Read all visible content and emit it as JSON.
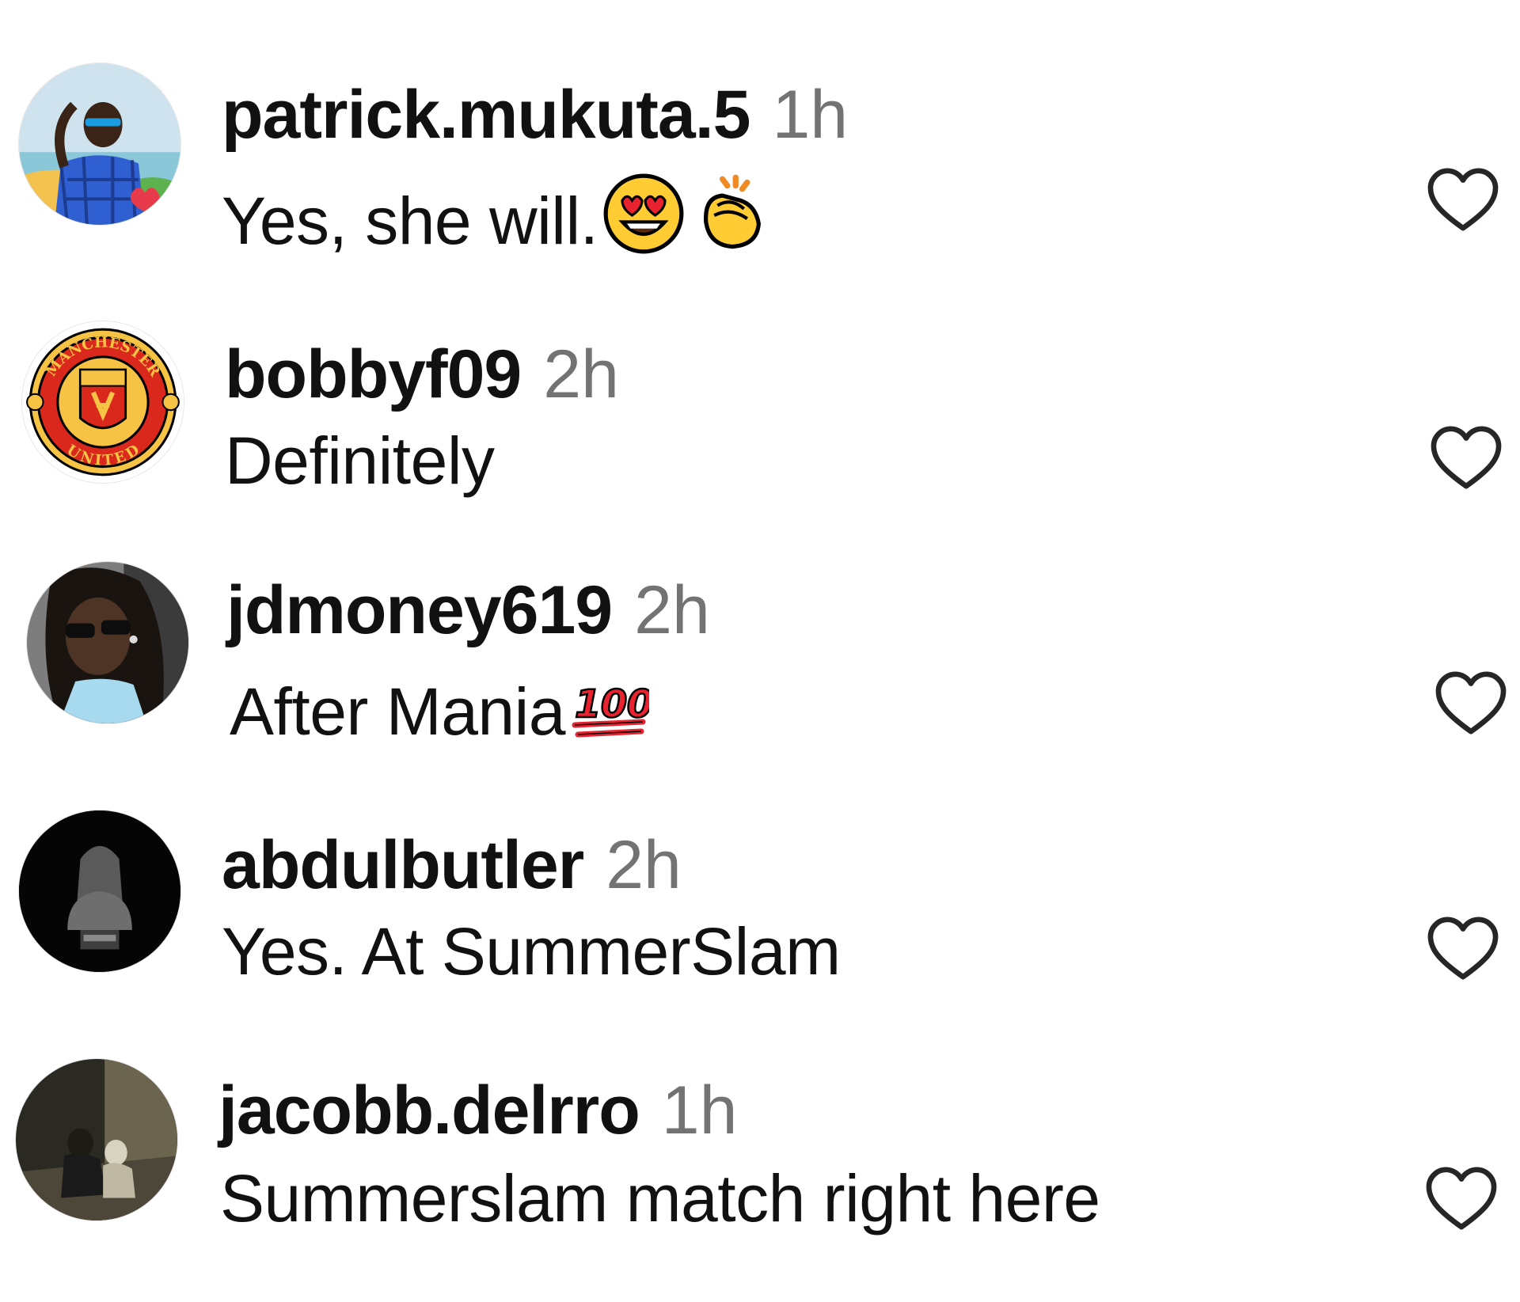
{
  "comments": [
    {
      "username": "patrick.mukuta.5",
      "time": "1h",
      "text": "Yes, she will.",
      "avatar": "person-blue-shirt-sunglasses-avatar",
      "emojis": [
        "heart-eyes-emoji",
        "clapping-hands-emoji"
      ],
      "liked": false
    },
    {
      "username": "bobbyf09",
      "time": "2h",
      "text": "Definitely",
      "avatar": "manchester-united-crest-avatar",
      "emojis": [],
      "liked": false
    },
    {
      "username": "jdmoney619",
      "time": "2h",
      "text": "After Mania",
      "avatar": "person-sunglasses-avatar",
      "emojis": [
        "hundred-points-emoji"
      ],
      "liked": false
    },
    {
      "username": "abdulbutler",
      "time": "2h",
      "text": "Yes. At SummerSlam",
      "avatar": "statue-bust-dark-avatar",
      "emojis": [],
      "liked": false
    },
    {
      "username": "jacobb.delrro",
      "time": "1h",
      "text": "Summerslam match right here",
      "avatar": "dark-photo-avatar",
      "emojis": [],
      "liked": false
    }
  ],
  "badges": {
    "crest_top": "MANCHESTER",
    "crest_bottom": "UNITED"
  },
  "colors": {
    "text": "#111111",
    "muted": "#737373",
    "heart_stroke": "#262626",
    "divider": "#e6e6e6"
  }
}
